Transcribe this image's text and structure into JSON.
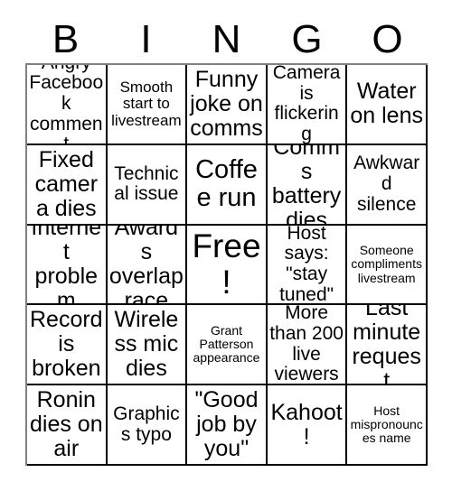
{
  "card": {
    "title": "BINGO",
    "header_letters": [
      "B",
      "I",
      "N",
      "G",
      "O"
    ],
    "rows": 5,
    "columns": 5,
    "colors": {
      "background": "#ffffff",
      "text": "#000000",
      "grid_line": "#000000",
      "outer_line": "#808080"
    },
    "cells": [
      [
        {
          "text": "Angry Facebook comment",
          "size": "md",
          "free": false
        },
        {
          "text": "Smooth start to livestream",
          "size": "sm",
          "free": false
        },
        {
          "text": "Funny joke on comms",
          "size": "lg",
          "free": false
        },
        {
          "text": "Camera is flickering",
          "size": "md",
          "free": false
        },
        {
          "text": "Water on lens",
          "size": "lg",
          "free": false
        }
      ],
      [
        {
          "text": "Fixed camera dies",
          "size": "lg",
          "free": false
        },
        {
          "text": "Technical issue",
          "size": "md",
          "free": false
        },
        {
          "text": "Coffee run",
          "size": "xl",
          "free": false
        },
        {
          "text": "Comms battery dies",
          "size": "lg",
          "free": false
        },
        {
          "text": "Awkward silence",
          "size": "md",
          "free": false
        }
      ],
      [
        {
          "text": "Internet problem",
          "size": "lg",
          "free": false
        },
        {
          "text": "Awards overlap race",
          "size": "lg",
          "free": false
        },
        {
          "text": "Free!",
          "size": "free",
          "free": true
        },
        {
          "text": "Host says: \"stay tuned\"",
          "size": "md",
          "free": false
        },
        {
          "text": "Someone compliments livestream",
          "size": "xs",
          "free": false
        }
      ],
      [
        {
          "text": "Record is broken",
          "size": "lg",
          "free": false
        },
        {
          "text": "Wireless mic dies",
          "size": "lg",
          "free": false
        },
        {
          "text": "Grant Patterson appearance",
          "size": "xs",
          "free": false
        },
        {
          "text": "More than 200 live viewers",
          "size": "md",
          "free": false
        },
        {
          "text": "Last minute request",
          "size": "lg",
          "free": false
        }
      ],
      [
        {
          "text": "Ronin dies on air",
          "size": "lg",
          "free": false
        },
        {
          "text": "Graphics typo",
          "size": "md",
          "free": false
        },
        {
          "text": "\"Good job by you\"",
          "size": "lg",
          "free": false
        },
        {
          "text": "Kahoot!",
          "size": "lg",
          "free": false
        },
        {
          "text": "Host mispronounces name",
          "size": "xs",
          "free": false
        }
      ]
    ]
  }
}
